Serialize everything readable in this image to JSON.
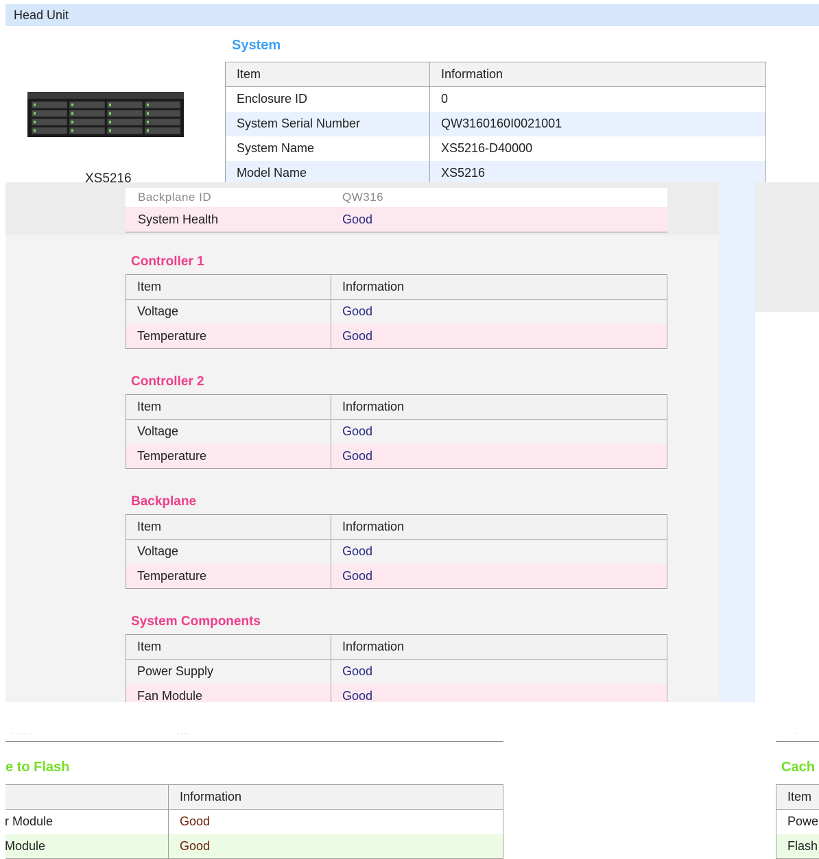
{
  "head_unit": {
    "title": "Head Unit",
    "device_name": "XS5216"
  },
  "system": {
    "title": "System",
    "headers": [
      "Item",
      "Information"
    ],
    "rows": [
      [
        "Enclosure ID",
        "0"
      ],
      [
        "System Serial Number",
        "QW3160160I0021001"
      ],
      [
        "System Name",
        "XS5216-D40000"
      ],
      [
        "Model Name",
        "XS5216"
      ]
    ]
  },
  "overlay_rows": [
    [
      "Backplane ID",
      "QW316"
    ],
    [
      "System Health",
      "Good"
    ]
  ],
  "controller1": {
    "title": "Controller 1",
    "headers": [
      "Item",
      "Information"
    ],
    "rows": [
      [
        "Voltage",
        "Good"
      ],
      [
        "Temperature",
        "Good"
      ]
    ]
  },
  "controller2": {
    "title": "Controller 2",
    "headers": [
      "Item",
      "Information"
    ],
    "rows": [
      [
        "Voltage",
        "Good"
      ],
      [
        "Temperature",
        "Good"
      ]
    ]
  },
  "backplane": {
    "title": "Backplane",
    "headers": [
      "Item",
      "Information"
    ],
    "rows": [
      [
        "Voltage",
        "Good"
      ],
      [
        "Temperature",
        "Good"
      ]
    ]
  },
  "system_components": {
    "title": "System Components",
    "headers": [
      "Item",
      "Information"
    ],
    "rows": [
      [
        "Power Supply",
        "Good"
      ],
      [
        "Fan Module",
        "Good"
      ]
    ]
  },
  "flash_section": {
    "title": "e to Flash",
    "headers": [
      "",
      "Information"
    ],
    "rows": [
      [
        "r Module",
        "Good"
      ],
      [
        "Module",
        "Good"
      ]
    ]
  },
  "cache_section": {
    "title": "Cach",
    "headers": [
      "Item"
    ],
    "rows": [
      "Powe",
      "Flash"
    ]
  },
  "colors": {
    "head_bar": "#d6e6fb",
    "system_title": "#3da0f0",
    "pink_title": "#ee3f8a",
    "green_title": "#74e027"
  }
}
